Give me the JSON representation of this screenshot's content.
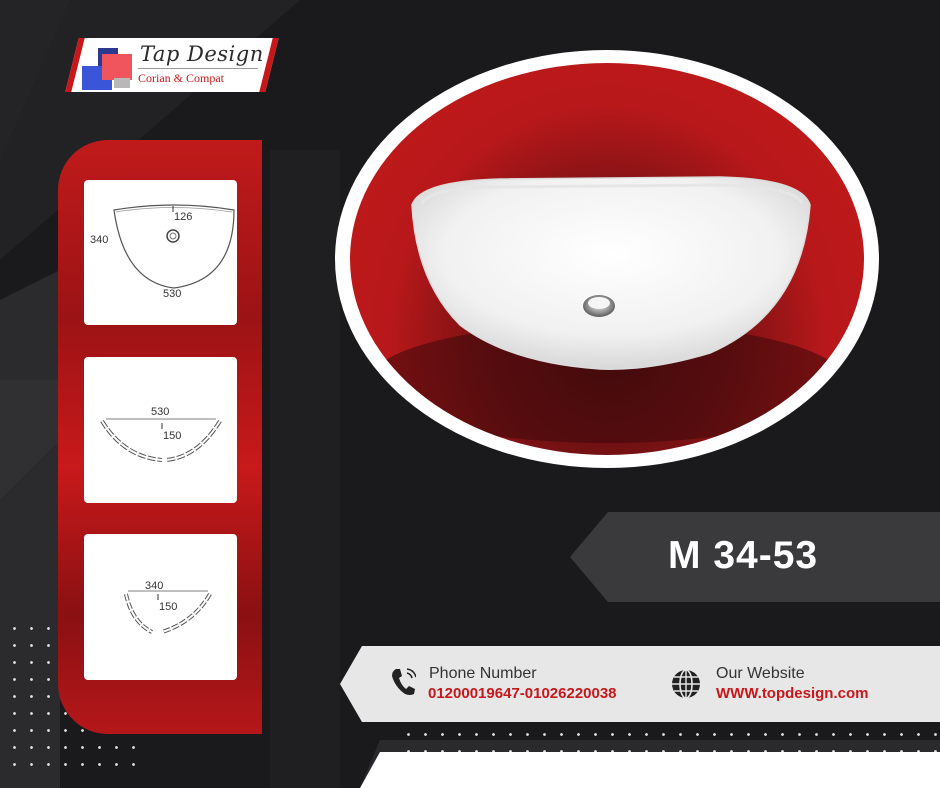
{
  "brand": {
    "name": "Tap Design",
    "tagline": "Corian & Compat"
  },
  "drawings": [
    {
      "view": "top",
      "width": "530",
      "depth": "340",
      "drain": "126"
    },
    {
      "view": "front",
      "width": "530",
      "height": "150"
    },
    {
      "view": "side",
      "width": "340",
      "height": "150"
    }
  ],
  "product": {
    "model": "M 34-53"
  },
  "contact": {
    "phone_label": "Phone Number",
    "phone_value": "01200019647-01026220038",
    "phone_icon": "phone-icon",
    "website_label": "Our Website",
    "website_value": "WWW.topdesign.com",
    "website_icon": "globe-icon"
  },
  "colors": {
    "accent_red": "#c8171a",
    "dark_bg": "#1a1a1d",
    "panel_grey": "#3a3a3d"
  }
}
